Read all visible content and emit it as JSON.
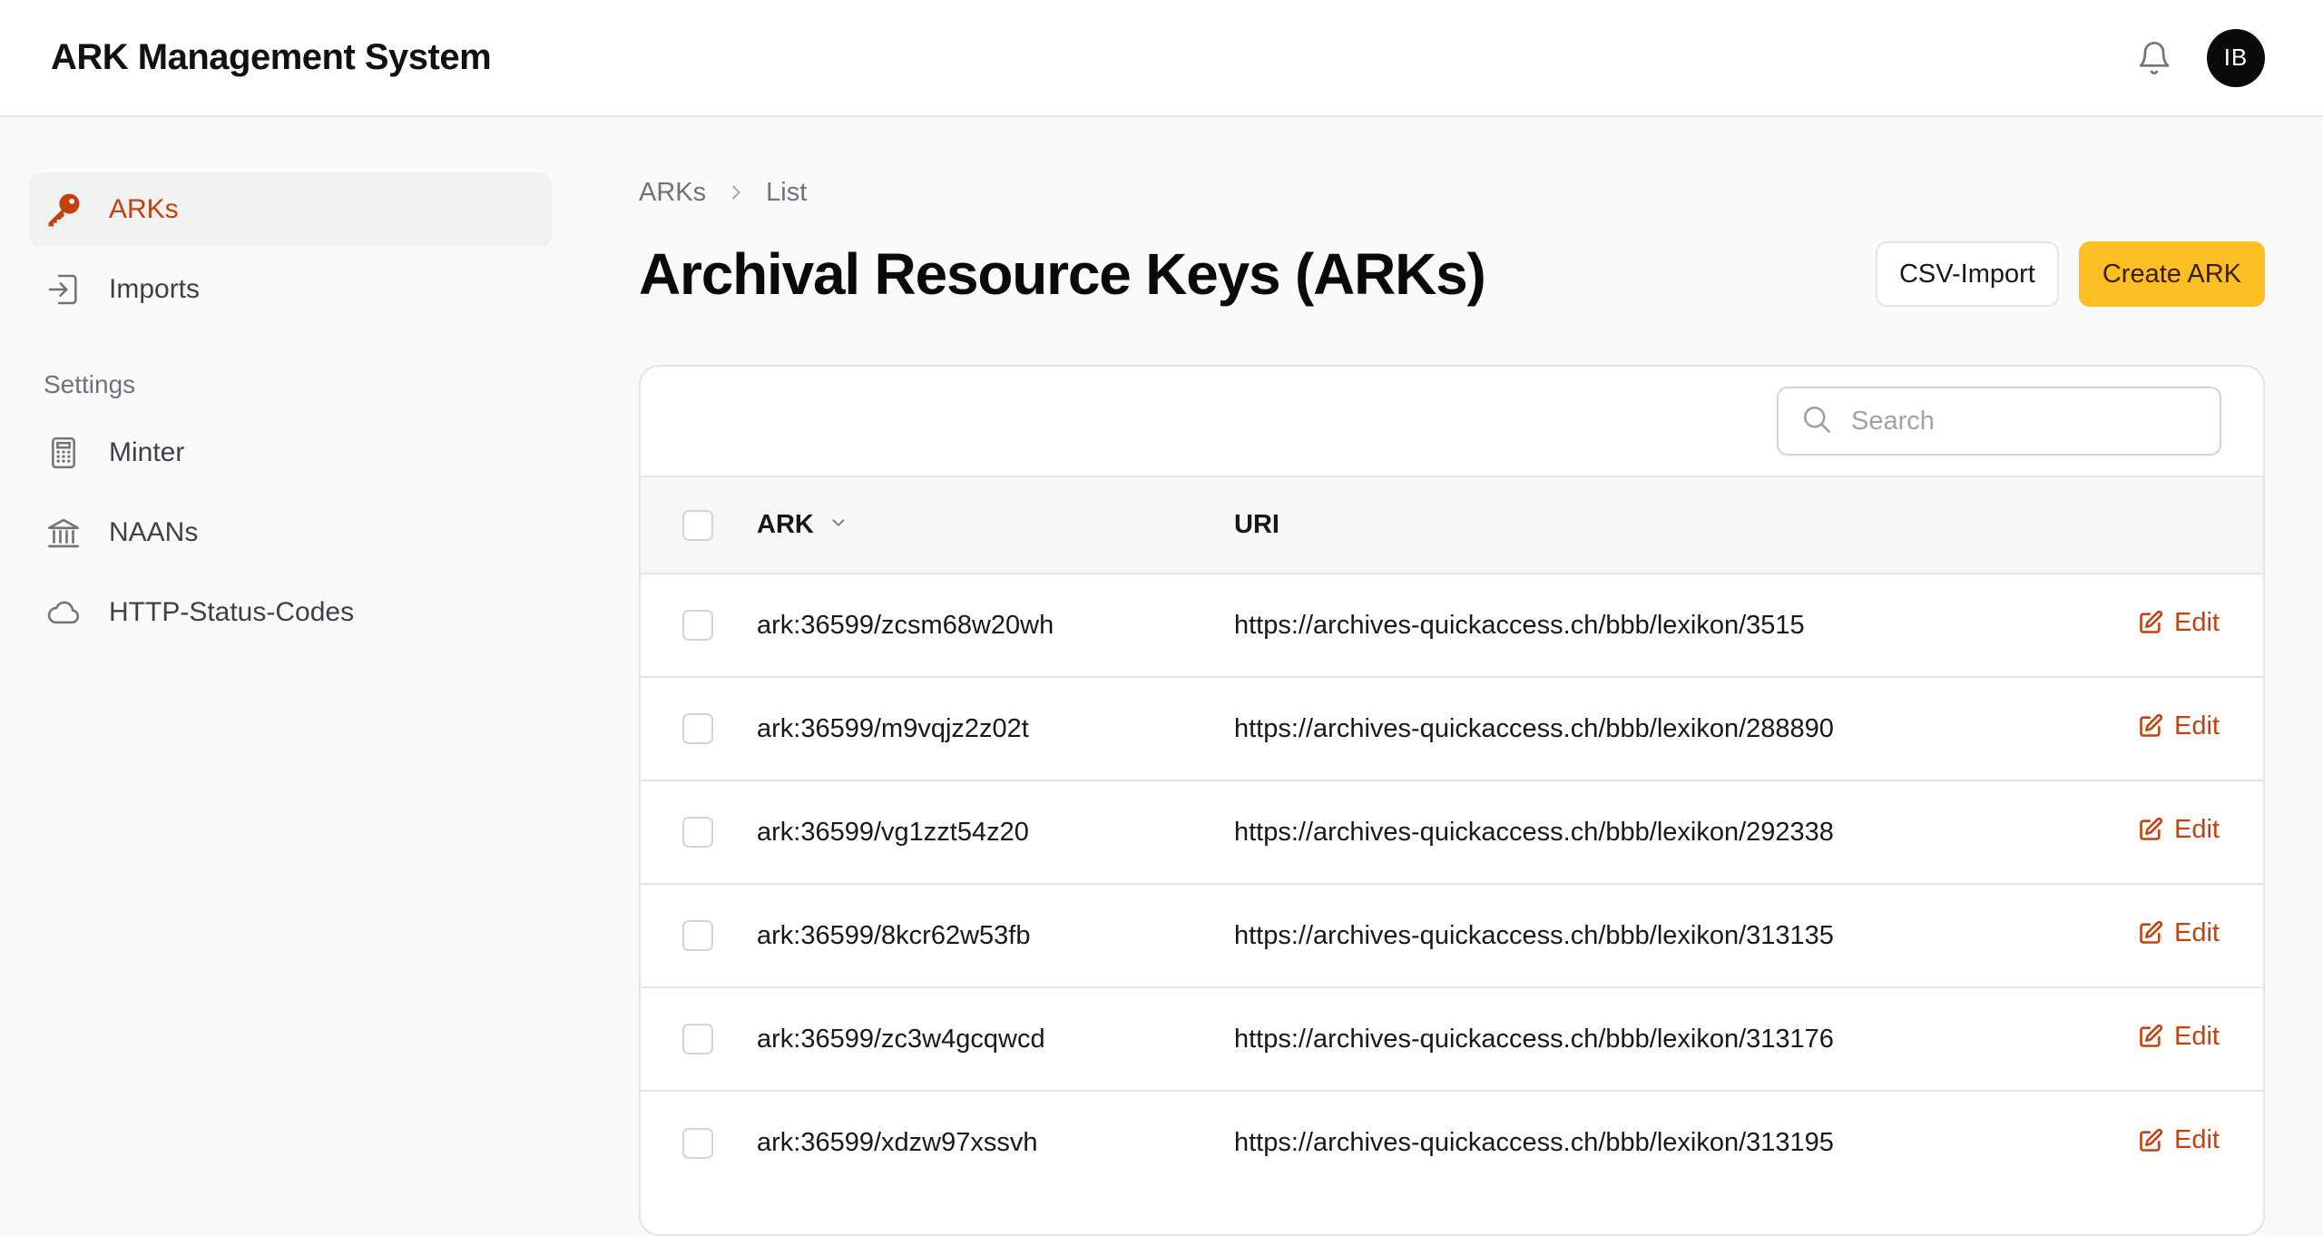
{
  "app": {
    "title": "ARK Management System"
  },
  "user": {
    "initials": "IB"
  },
  "sidebar": {
    "items": [
      {
        "label": "ARKs",
        "icon": "key-icon"
      },
      {
        "label": "Imports",
        "icon": "import-icon"
      }
    ],
    "settings_label": "Settings",
    "settings_items": [
      {
        "label": "Minter",
        "icon": "calculator-icon"
      },
      {
        "label": "NAANs",
        "icon": "bank-icon"
      },
      {
        "label": "HTTP-Status-Codes",
        "icon": "cloud-icon"
      }
    ]
  },
  "breadcrumb": {
    "parent": "ARKs",
    "current": "List"
  },
  "page": {
    "title": "Archival Resource Keys (ARKs)"
  },
  "actions": {
    "csv_import": "CSV-Import",
    "create": "Create ARK"
  },
  "search": {
    "placeholder": "Search",
    "value": ""
  },
  "table": {
    "columns": {
      "ark": "ARK",
      "uri": "URI"
    },
    "edit_label": "Edit",
    "rows": [
      {
        "ark": "ark:36599/zcsm68w20wh",
        "uri": "https://archives-quickaccess.ch/bbb/lexikon/3515"
      },
      {
        "ark": "ark:36599/m9vqjz2z02t",
        "uri": "https://archives-quickaccess.ch/bbb/lexikon/288890"
      },
      {
        "ark": "ark:36599/vg1zzt54z20",
        "uri": "https://archives-quickaccess.ch/bbb/lexikon/292338"
      },
      {
        "ark": "ark:36599/8kcr62w53fb",
        "uri": "https://archives-quickaccess.ch/bbb/lexikon/313135"
      },
      {
        "ark": "ark:36599/zc3w4gcqwcd",
        "uri": "https://archives-quickaccess.ch/bbb/lexikon/313176"
      },
      {
        "ark": "ark:36599/xdzw97xssvh",
        "uri": "https://archives-quickaccess.ch/bbb/lexikon/313195"
      }
    ]
  },
  "colors": {
    "accent": "#c2410c",
    "primary_button": "#fbbf24"
  }
}
